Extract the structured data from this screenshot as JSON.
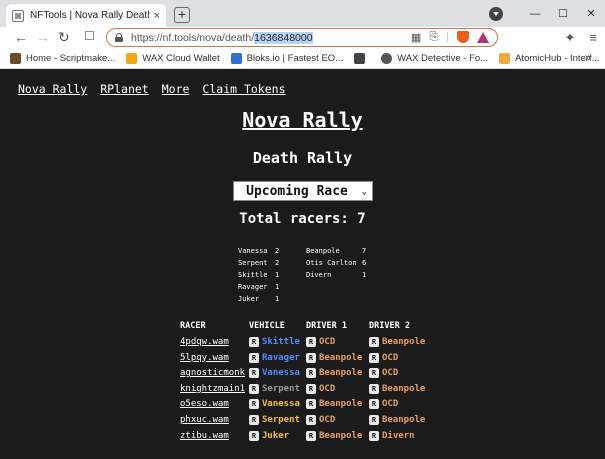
{
  "browser": {
    "tab_title": "NFTools | Nova Rally Death Rally",
    "tab_close": "×",
    "new_tab": "+",
    "url_prefix": "https://nf.tools/nova/death/",
    "url_selected": "1636848000",
    "window_buttons": [
      "—",
      "☐",
      "✕"
    ],
    "bookmarks": [
      {
        "label": "Home - Scriptmake...",
        "color": "#6b4b2a"
      },
      {
        "label": "WAX Cloud Wallet",
        "color": "#f3a712"
      },
      {
        "label": "Bloks.io | Fastest EO...",
        "color": "#2f6fd1"
      },
      {
        "label": "",
        "color": "#444444"
      },
      {
        "label": "WAX Detective - Fo...",
        "color": "#555555"
      },
      {
        "label": "AtomicHub - Interf...",
        "color": "#f0a93b"
      }
    ],
    "bookmarks_overflow": "»"
  },
  "nav": {
    "links": [
      "Nova Rally",
      "RPlanet",
      "More",
      "Claim Tokens"
    ]
  },
  "page": {
    "title": "Nova Rally",
    "subtitle": "Death Rally",
    "race_select": "Upcoming Race",
    "total_racers": "Total racers: 7"
  },
  "counts": {
    "left": [
      {
        "name": "Vanessa",
        "count": "2"
      },
      {
        "name": "Serpent",
        "count": "2"
      },
      {
        "name": "Skittle",
        "count": "1"
      },
      {
        "name": "Ravager",
        "count": "1"
      },
      {
        "name": "Juker",
        "count": "1"
      }
    ],
    "right": [
      {
        "name": "Beanpole",
        "count": "7"
      },
      {
        "name": "Otis Carlton",
        "count": "6"
      },
      {
        "name": "Divern",
        "count": "1"
      }
    ]
  },
  "table": {
    "headers": [
      "RACER",
      "VEHICLE",
      "DRIVER 1",
      "DRIVER 2"
    ],
    "badge": "R",
    "rows": [
      {
        "racer": "4pdqw.wam",
        "vehicle": "Skittle",
        "vcolor": "#4f8cff",
        "d1": "OCD",
        "d2": "Beanpole"
      },
      {
        "racer": "5lpqy.wam",
        "vehicle": "Ravager",
        "vcolor": "#4f8cff",
        "d1": "Beanpole",
        "d2": "OCD"
      },
      {
        "racer": "agnosticmonk",
        "vehicle": "Vanessa",
        "vcolor": "#4f8cff",
        "d1": "Beanpole",
        "d2": "OCD"
      },
      {
        "racer": "knightzmain1",
        "vehicle": "Serpent",
        "vcolor": "#9a9a9a",
        "d1": "OCD",
        "d2": "Beanpole"
      },
      {
        "racer": "o5eso.wam",
        "vehicle": "Vanessa",
        "vcolor": "#f2c12e",
        "d1": "Beanpole",
        "d2": "OCD"
      },
      {
        "racer": "phxuc.wam",
        "vehicle": "Serpent",
        "vcolor": "#f2c12e",
        "d1": "OCD",
        "d2": "Beanpole"
      },
      {
        "racer": "ztibu.wam",
        "vehicle": "Juker",
        "vcolor": "#f2c12e",
        "d1": "Beanpole",
        "d2": "Divern"
      }
    ],
    "driver_color": "#e8a15e"
  }
}
